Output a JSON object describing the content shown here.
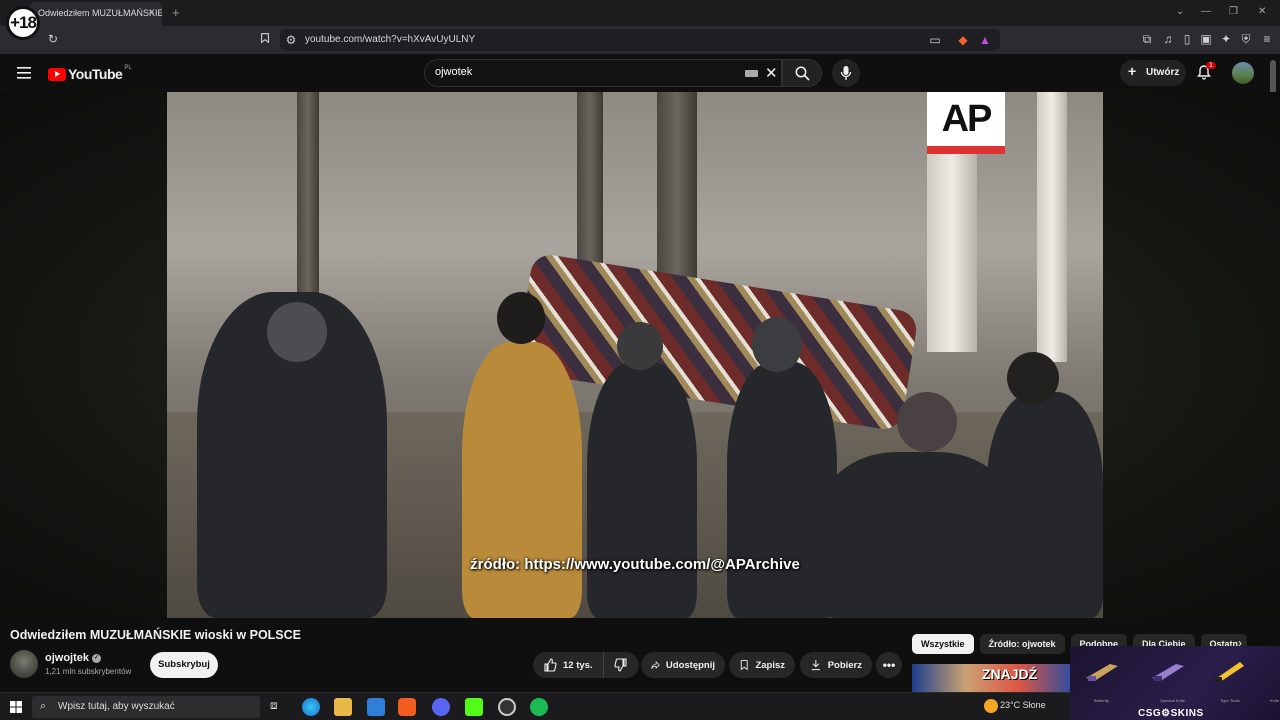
{
  "browser": {
    "tab_title": "Odwiedziłem MUZUŁMAŃSKIE",
    "age_badge": "+18",
    "url": "youtube.com/watch?v=hXvAvUyULNY",
    "new_tab": "+",
    "tab_close": "×"
  },
  "youtube": {
    "logo_text": "YouTube",
    "logo_region": "PL",
    "search_value": "ojwotek",
    "create_label": "Utwórz",
    "notification_count": "1"
  },
  "video": {
    "watermark": "AP",
    "caption": "źródło: https://www.youtube.com/@APArchive"
  },
  "meta": {
    "title": "Odwiedziłem MUZUŁMAŃSKIE wioski w POLSCE",
    "channel_name": "ojwojtek",
    "subscribers": "1,21 mln subskrybentów",
    "subscribe_label": "Subskrybuj",
    "likes": "12 tys.",
    "share_label": "Udostępnij",
    "save_label": "Zapisz",
    "download_label": "Pobierz"
  },
  "chips": [
    "Wszystkie",
    "Źródło: ojwotek",
    "Podobne",
    "Dla Ciebie",
    "Ostatn"
  ],
  "recommendation": {
    "thumb_text": "ZNAJDŹ"
  },
  "ad": {
    "brand": "CSG⚙SKINS",
    "items": [
      "Butterfly",
      "Spectral Knife",
      "Tiger Tooth",
      "Knife"
    ]
  },
  "taskbar": {
    "search_placeholder": "Wpisz tutaj, aby wyszukać",
    "weather": "23°C  Słone"
  },
  "colors": {
    "yt_red": "#ff0000",
    "background": "#0f0f0f",
    "ap_red": "#dd3333"
  }
}
